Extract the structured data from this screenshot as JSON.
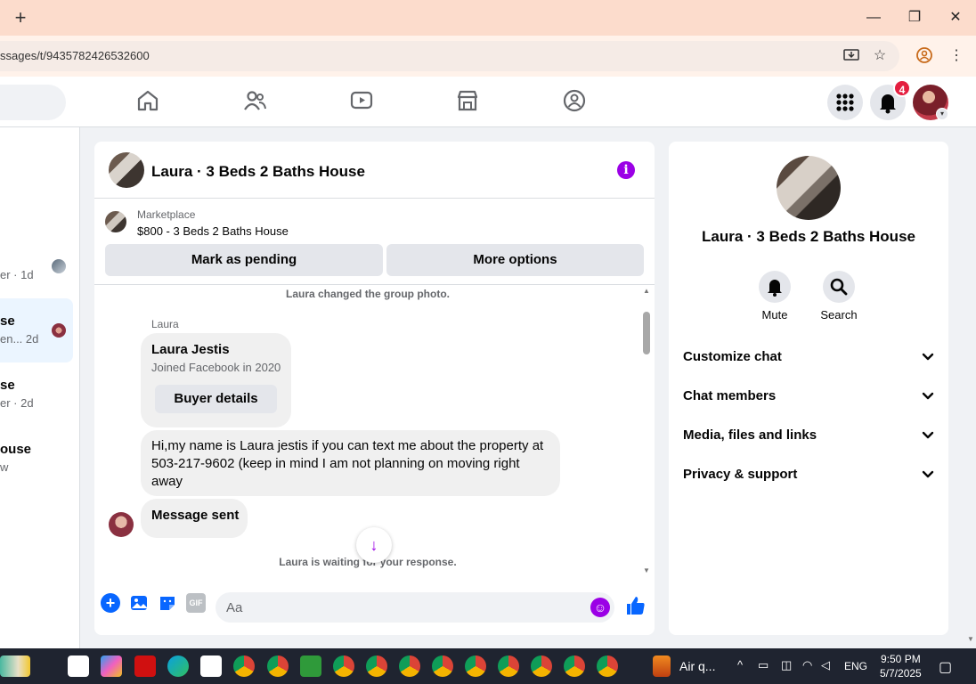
{
  "browser": {
    "new_tab": "+",
    "url": "ssages/t/9435782426532600",
    "minimize": "—",
    "restore": "❐",
    "close": "✕"
  },
  "header": {
    "notifications_count": "4"
  },
  "left_list": {
    "items": [
      {
        "title": "",
        "sub": "er · 1d"
      },
      {
        "title": "se",
        "sub": "en...  2d"
      },
      {
        "title": "se",
        "sub": "er · 2d"
      },
      {
        "title": "ouse",
        "sub": "w"
      }
    ]
  },
  "chat": {
    "title": "Laura · 3 Beds 2 Baths House",
    "marketplace_label": "Marketplace",
    "listing": "$800 - 3 Beds 2 Baths House",
    "mark_pending": "Mark as pending",
    "more_options": "More options",
    "sys_changed_photo": "Laura changed the group photo.",
    "sender_name": "Laura",
    "buyer_name": "Laura Jestis",
    "buyer_joined": "Joined Facebook in 2020",
    "buyer_details": "Buyer details",
    "message_1": "Hi,my name is Laura jestis if you can text me about the property at 503-217-9602 (keep in mind I am not planning on moving right away",
    "message_2": "Message sent",
    "sys_waiting": "Laura is waiting for your response.",
    "composer_placeholder": "Aa",
    "gif_label": "GIF"
  },
  "info_panel": {
    "title": "Laura · 3 Beds 2 Baths House",
    "mute": "Mute",
    "search": "Search",
    "rows": [
      "Customize chat",
      "Chat members",
      "Media, files and links",
      "Privacy & support"
    ]
  },
  "taskbar": {
    "weather": "Air q...",
    "lang": "ENG",
    "time": "9:50 PM",
    "date": "5/7/2025"
  },
  "colors": {
    "accent": "#9b00e6",
    "messenger_blue": "#0866ff",
    "badge": "#e41e3f"
  }
}
